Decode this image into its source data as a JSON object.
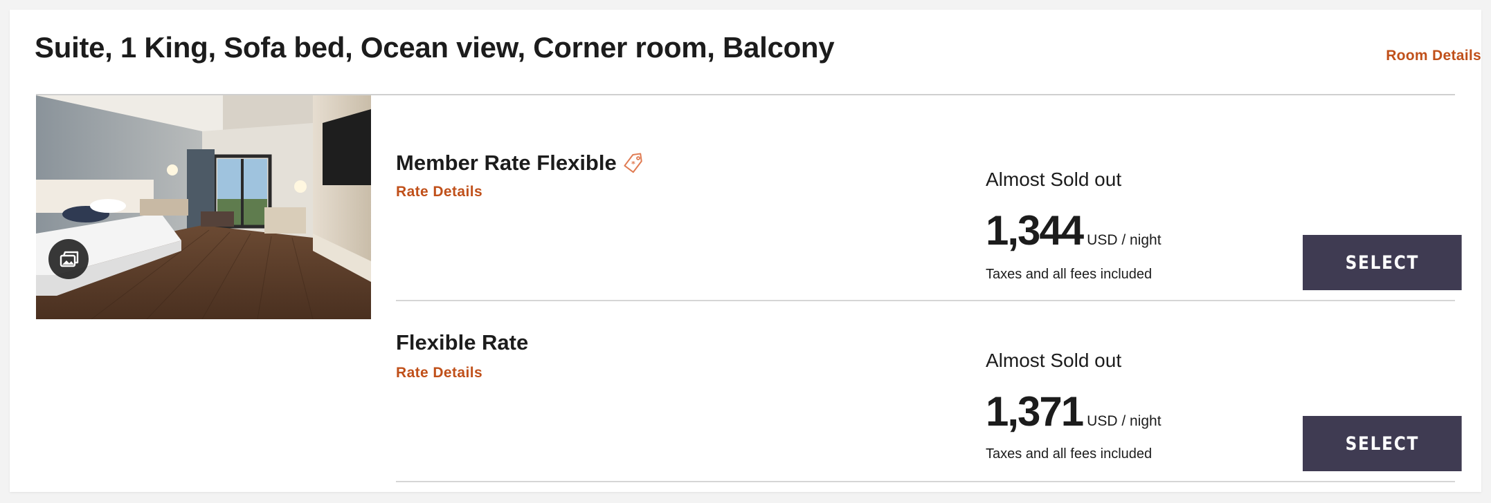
{
  "room": {
    "title": "Suite, 1 King, Sofa bed, Ocean view, Corner room, Balcony",
    "details_link": "Room Details",
    "photo_icon": "gallery-icon"
  },
  "rates": [
    {
      "name": "Member Rate Flexible",
      "badge_icon": "member-tag-icon",
      "details_link": "Rate Details",
      "availability": "Almost Sold out",
      "price": "1,344",
      "unit": "USD / night",
      "note": "Taxes and all fees included",
      "button": "SELECT"
    },
    {
      "name": "Flexible Rate",
      "details_link": "Rate Details",
      "availability": "Almost Sold out",
      "price": "1,371",
      "unit": "USD / night",
      "note": "Taxes and all fees included",
      "button": "SELECT"
    }
  ],
  "colors": {
    "accent": "#c0501a",
    "button": "#3f3b52",
    "text": "#1c1c1c",
    "divider": "#d5d5d5"
  }
}
